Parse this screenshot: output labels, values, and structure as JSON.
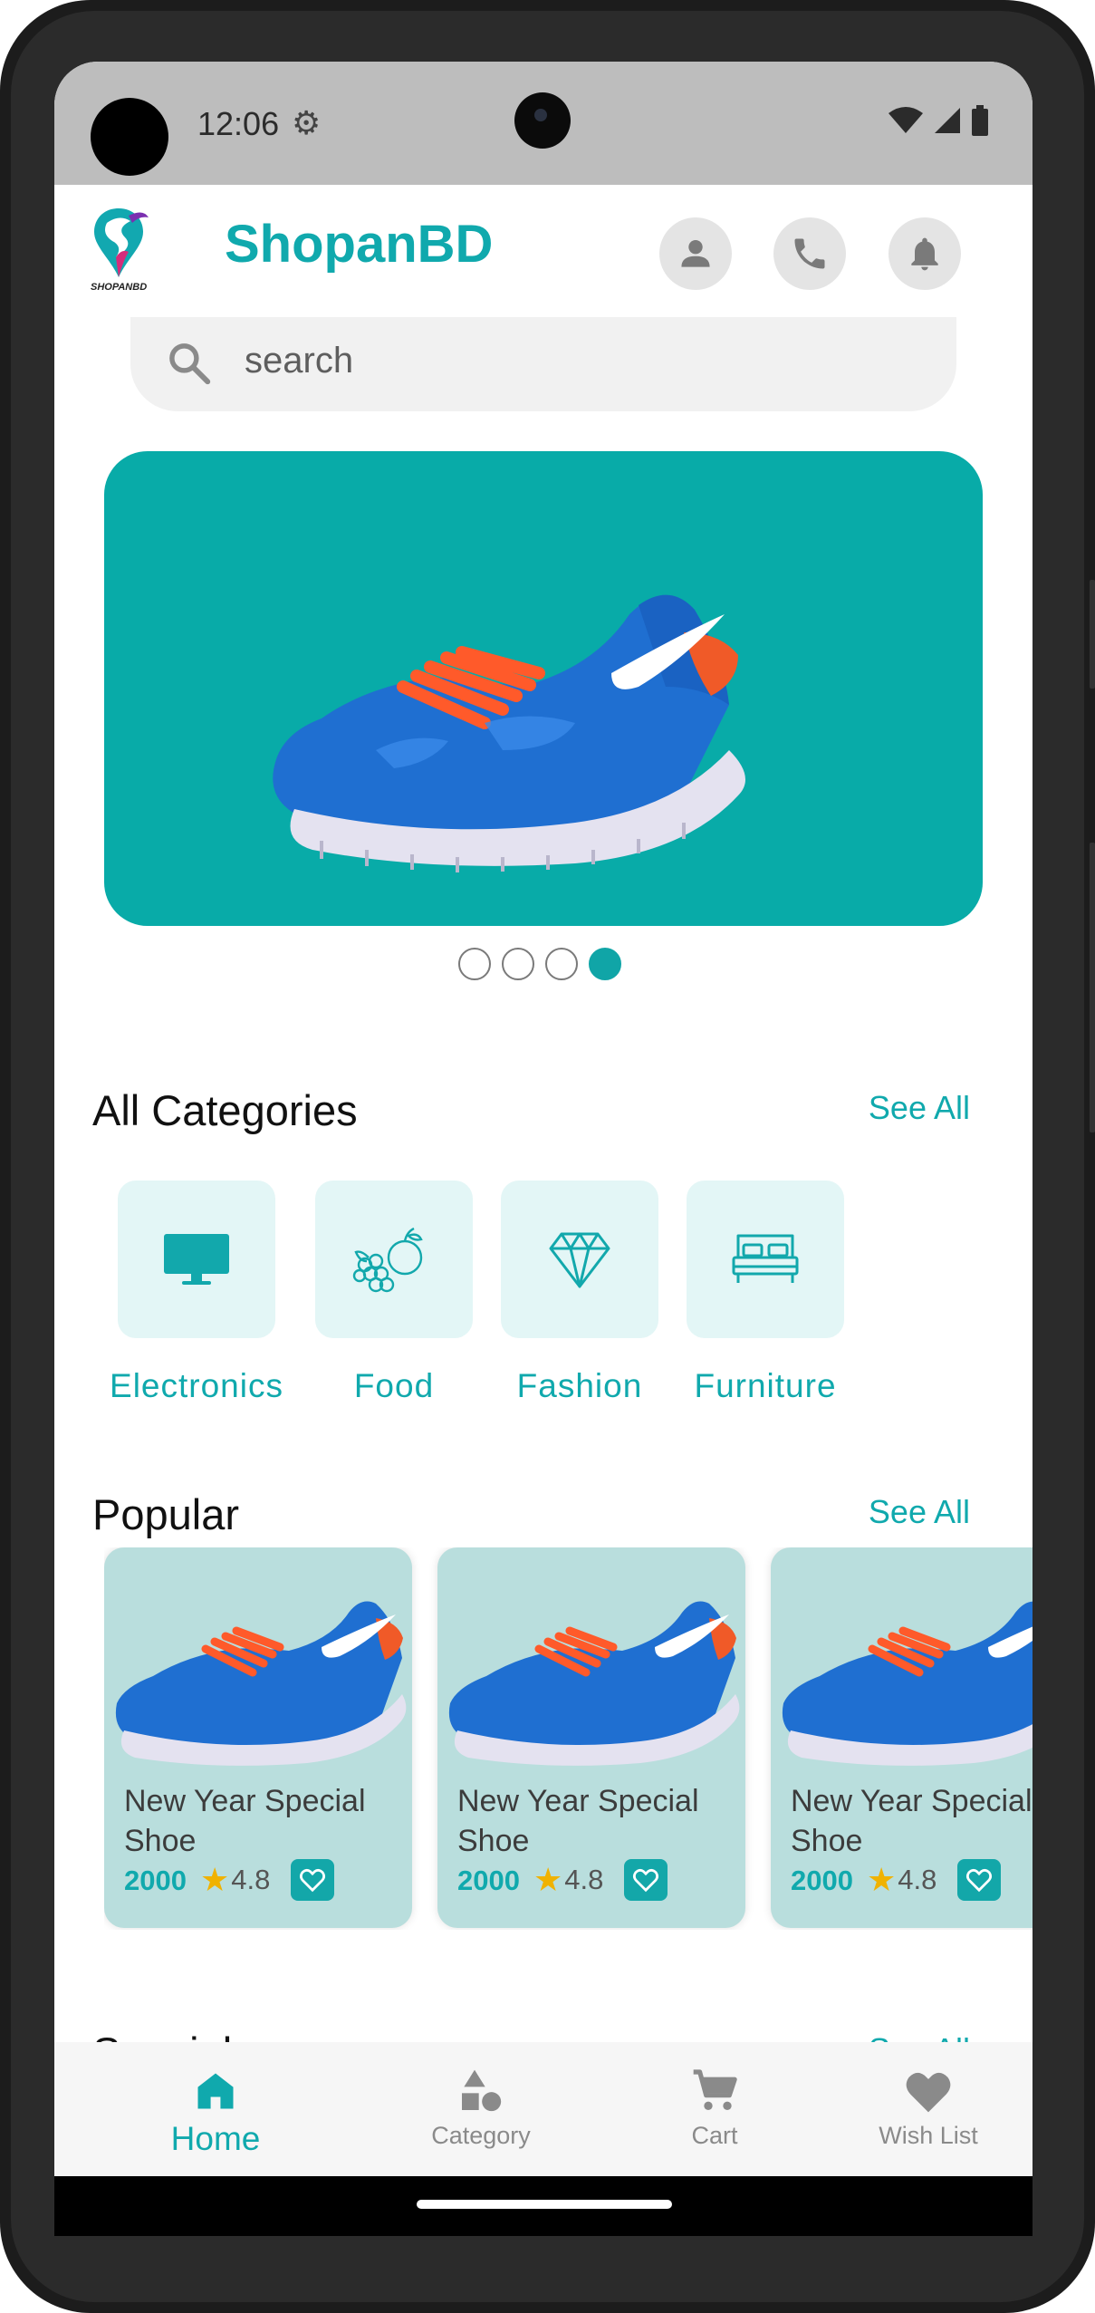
{
  "status_bar": {
    "time": "12:06"
  },
  "header": {
    "brand": "ShopanBD",
    "logo_text": "SHOPANBD"
  },
  "search": {
    "placeholder": "search"
  },
  "banner": {
    "slides": 4,
    "active_slide": 4
  },
  "categories": {
    "title": "All Categories",
    "see_all": "See All",
    "items": [
      {
        "label": "Electronics",
        "icon": "monitor-icon"
      },
      {
        "label": "Food",
        "icon": "fruits-icon"
      },
      {
        "label": "Fashion",
        "icon": "diamond-icon"
      },
      {
        "label": "Furniture",
        "icon": "bed-icon"
      }
    ]
  },
  "popular": {
    "title": "Popular",
    "see_all": "See All",
    "products": [
      {
        "name": "New Year Special Shoe",
        "price": "2000",
        "rating": "4.8"
      },
      {
        "name": "New Year Special Shoe",
        "price": "2000",
        "rating": "4.8"
      },
      {
        "name": "New Year Special Shoe",
        "price": "2000",
        "rating": "4.8"
      }
    ]
  },
  "special": {
    "title": "Special",
    "see_all": "See All"
  },
  "bottom_nav": {
    "items": [
      {
        "label": "Home",
        "icon": "home-icon",
        "active": true
      },
      {
        "label": "Category",
        "icon": "shapes-icon",
        "active": false
      },
      {
        "label": "Cart",
        "icon": "cart-icon",
        "active": false
      },
      {
        "label": "Wish List",
        "icon": "heart-icon",
        "active": false
      }
    ]
  },
  "colors": {
    "accent": "#10a9ad",
    "banner": "#08aba8",
    "card": "#b9dedd",
    "category_bg": "#e3f6f6"
  }
}
